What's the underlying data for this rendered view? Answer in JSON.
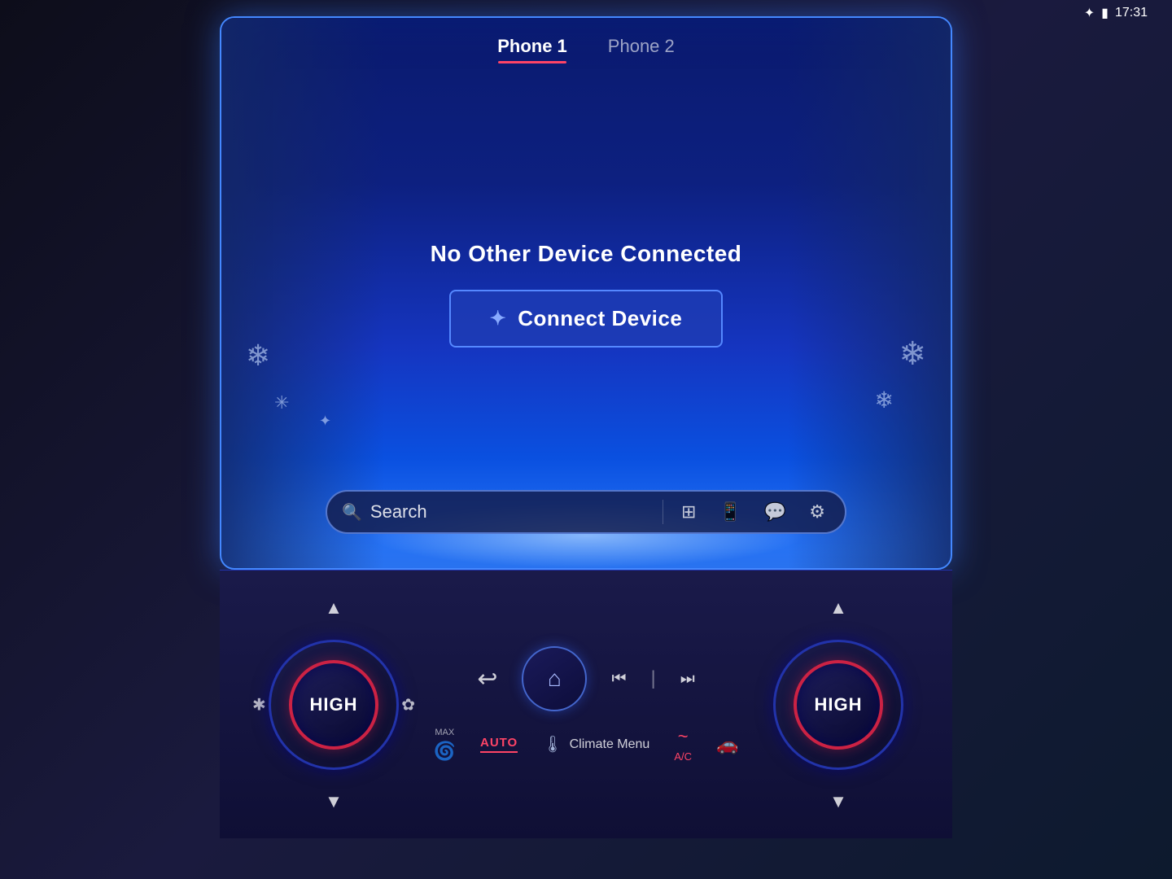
{
  "statusBar": {
    "time": "17:31",
    "btIcon": "⚡",
    "batteryIcon": "🔋"
  },
  "phoneTabs": {
    "tab1": {
      "label": "Phone 1",
      "active": true
    },
    "tab2": {
      "label": "Phone 2",
      "active": false
    }
  },
  "mainContent": {
    "noDeviceText": "No Other Device Connected",
    "connectDeviceBtn": "Connect Device"
  },
  "searchBar": {
    "placeholder": "Search",
    "searchLabel": "Search"
  },
  "bottomControls": {
    "leftKnob": {
      "label": "HIGH"
    },
    "rightKnob": {
      "label": "HIGH"
    },
    "climate": {
      "autoLabel": "AUTO",
      "acLabel": "A/C",
      "climateMenuLabel": "Climate Menu"
    },
    "mediaControls": {
      "backLabel": "↩",
      "prevLabel": "⏮",
      "nextLabel": "⏭"
    }
  }
}
